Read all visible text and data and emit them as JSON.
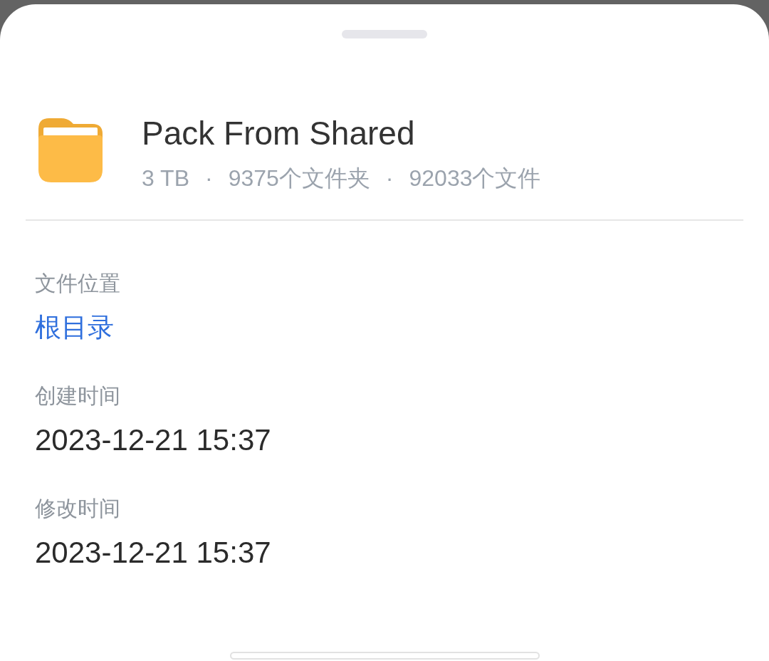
{
  "header": {
    "title": "Pack From Shared",
    "meta": [
      {
        "kind": "value",
        "text": "3 TB"
      },
      {
        "kind": "separator",
        "text": "·"
      },
      {
        "kind": "value",
        "text": "9375个文件夹"
      },
      {
        "kind": "separator",
        "text": "·"
      },
      {
        "kind": "value",
        "text": "92033个文件"
      }
    ]
  },
  "details": [
    {
      "label": "文件位置",
      "value": "根目录",
      "kind": "link"
    },
    {
      "label": "创建时间",
      "value": "2023-12-21 15:37",
      "kind": "text"
    },
    {
      "label": "修改时间",
      "value": "2023-12-21 15:37",
      "kind": "text"
    }
  ]
}
